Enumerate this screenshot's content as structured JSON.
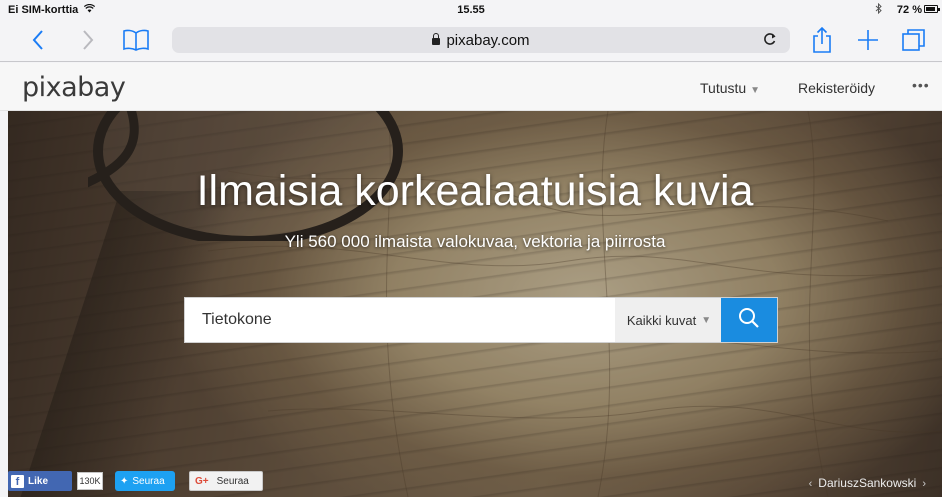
{
  "status_bar": {
    "carrier": "Ei SIM-korttia",
    "time": "15.55",
    "battery": "72 %"
  },
  "browser": {
    "url": "pixabay.com",
    "icons": [
      "back-icon",
      "forward-icon",
      "bookmarks-icon",
      "lock-icon",
      "reload-icon",
      "share-icon",
      "new-tab-icon",
      "tabs-icon"
    ],
    "accent_color": "#1a7cf5"
  },
  "site": {
    "logo": "pixabay",
    "nav": {
      "explore": "Tutustu",
      "register": "Rekisteröidy",
      "more": "•••"
    }
  },
  "hero": {
    "title": "Ilmaisia korkealaatuisia kuvia",
    "subtitle": "Yli 560 000 ilmaista valokuvaa, vektoria ja piirrosta",
    "search": {
      "value": "Tietokone",
      "type": "Kaikki kuvat",
      "button_color": "#1a8ce0"
    },
    "social": {
      "fb_like": "Like",
      "fb_count": "130K",
      "twitter": "Seuraa",
      "gplus": "Seuraa"
    },
    "credit": "DariuszSankowski"
  }
}
